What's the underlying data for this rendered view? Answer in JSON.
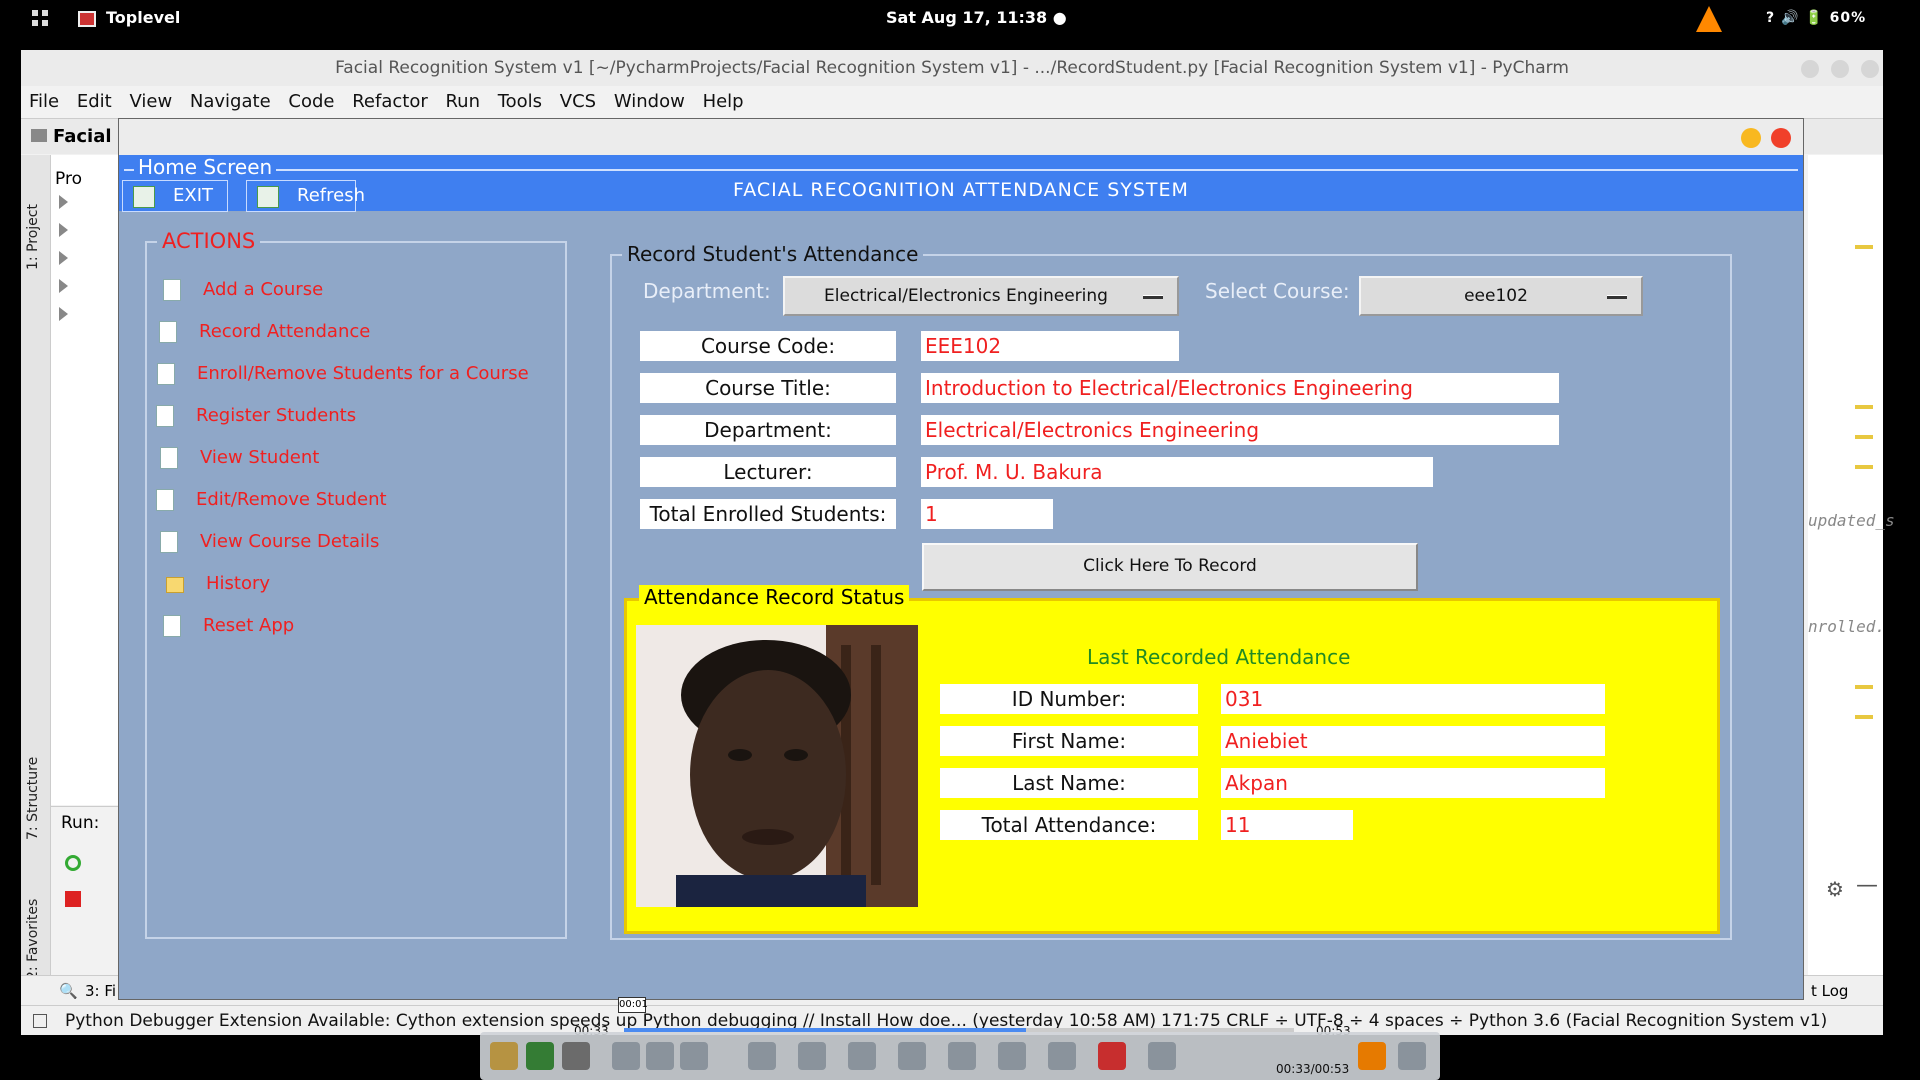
{
  "topbar": {
    "app_name": "Toplevel",
    "clock": "Sat Aug 17, 11:38 ●",
    "tray": "?   🔊   🔋 60%"
  },
  "pycharm": {
    "title": "Facial Recognition System v1 [~/PycharmProjects/Facial Recognition System v1] - .../RecordStudent.py [Facial Recognition System v1] - PyCharm",
    "menu": [
      "File",
      "Edit",
      "View",
      "Navigate",
      "Code",
      "Refactor",
      "Run",
      "Tools",
      "VCS",
      "Window",
      "Help"
    ],
    "nav_crumb": "Facial",
    "project_tab": "1: Project",
    "project_root": "Pro",
    "structure_tab": "7: Structure",
    "favorites_tab": "2: Favorites",
    "run_label": "Run:",
    "find_tab": "3: Fi",
    "event_log": "t Log",
    "editor_snippets": [
      "updated_s",
      "nrolled."
    ],
    "status_message": "Python Debugger Extension Available: Cython extension speeds up Python debugging // Install How doe... (yesterday 10:58 AM)",
    "status_info": "171:75   CRLF ÷   UTF-8 ÷   4 spaces ÷   Python 3.6 (Facial Recognition System v1)"
  },
  "app": {
    "home_label": "Home Screen",
    "title": "FACIAL RECOGNITION ATTENDANCE SYSTEM",
    "exit_label": "EXIT",
    "refresh_label": "Refresh",
    "actions_title": "ACTIONS",
    "actions": [
      {
        "label": "Add a Course",
        "icon": "add-course-icon"
      },
      {
        "label": "Record Attendance",
        "icon": "record-icon"
      },
      {
        "label": "Enroll/Remove Students for a Course",
        "icon": "enroll-icon"
      },
      {
        "label": "Register Students",
        "icon": "register-icon"
      },
      {
        "label": "View Student",
        "icon": "view-icon"
      },
      {
        "label": "Edit/Remove Student",
        "icon": "edit-icon"
      },
      {
        "label": "View Course Details",
        "icon": "details-icon"
      },
      {
        "label": "History",
        "icon": "folder-icon"
      },
      {
        "label": "Reset App",
        "icon": "reset-icon"
      }
    ],
    "record_title": "Record Student's Attendance",
    "department_label": "Department:",
    "department_value": "Electrical/Electronics Engineering",
    "course_label": "Select Course:",
    "course_value": "eee102",
    "fields": {
      "course_code_label": "Course Code:",
      "course_code": "EEE102",
      "course_title_label": "Course Title:",
      "course_title": "Introduction to Electrical/Electronics Engineering",
      "department_label": "Department:",
      "department": "Electrical/Electronics Engineering",
      "lecturer_label": "Lecturer:",
      "lecturer": "Prof. M. U. Bakura",
      "enrolled_label": "Total Enrolled Students:",
      "enrolled": "1"
    },
    "record_button": "Click Here To Record",
    "status_title": "Attendance Record Status",
    "last_recorded": "Last Recorded Attendance",
    "student": {
      "id_label": "ID Number:",
      "id": "031",
      "first_label": "First Name:",
      "first": "Aniebiet",
      "last_label": "Last Name:",
      "last": "Akpan",
      "total_label": "Total Attendance:",
      "total": "11"
    }
  },
  "media": {
    "time_left": "00:33",
    "time_right": "00:53",
    "time_combined": "00:33/00:53",
    "tooltip": "00:01"
  }
}
